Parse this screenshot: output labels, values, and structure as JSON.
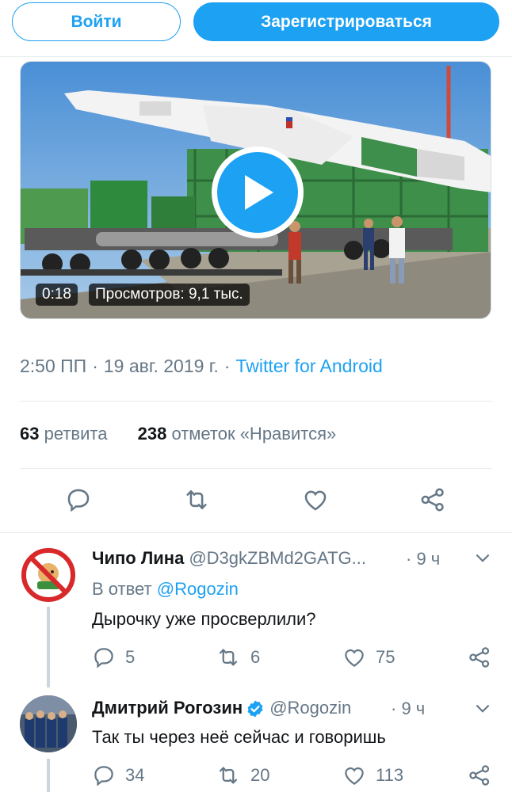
{
  "auth": {
    "login_label": "Войти",
    "signup_label": "Зарегистрироваться"
  },
  "colors": {
    "accent": "#1da1f2",
    "text_secondary": "#657786",
    "text_primary": "#14171a",
    "divider": "#e6ecf0"
  },
  "video": {
    "duration": "0:18",
    "views": "Просмотров: 9,1 тыс.",
    "play_icon": "play-icon"
  },
  "tweet_meta": {
    "time": "2:50 ПП",
    "separator": "·",
    "date": "19 авг. 2019 г.",
    "source": "Twitter for Android"
  },
  "stats": {
    "retweets_count": "63",
    "retweets_label": "ретвита",
    "likes_count": "238",
    "likes_label": "отметок «Нравится»"
  },
  "actions": [
    "reply-icon",
    "retweet-icon",
    "like-icon",
    "share-icon"
  ],
  "replies": [
    {
      "name": "Чипо Лина",
      "handle": "@D3gkZBMd2GATG...",
      "time": "· 9 ч",
      "in_reply_prefix": "В ответ",
      "in_reply_handle": "@Rogozin",
      "text": "Дырочку уже просверлили?",
      "reply_count": "5",
      "retweet_count": "6",
      "like_count": "75"
    },
    {
      "name": "Дмитрий Рогозин",
      "handle": "@Rogozin",
      "time": "· 9 ч",
      "verified": true,
      "text": "Так ты через неё сейчас и говоришь",
      "reply_count": "34",
      "retweet_count": "20",
      "like_count": "113"
    }
  ]
}
